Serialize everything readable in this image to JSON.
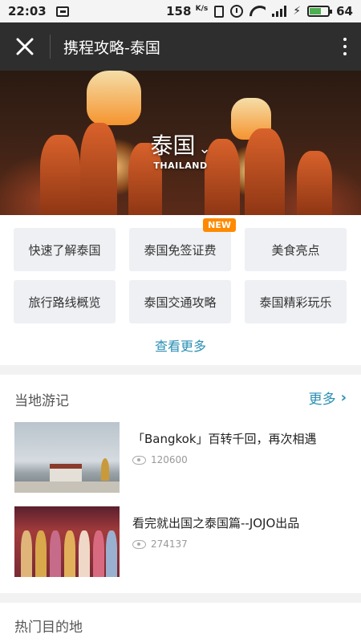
{
  "status_bar": {
    "time": "22:03",
    "speed": "158",
    "speed_unit": "K/s",
    "battery": "64",
    "battery_level": 0.64
  },
  "header": {
    "close_icon": "close-icon",
    "title": "携程攻略-泰国",
    "more_icon": "more-vertical-icon"
  },
  "hero": {
    "title": "泰国",
    "subtitle": "THAILAND"
  },
  "quick_links": {
    "items": [
      {
        "label": "快速了解泰国"
      },
      {
        "label": "泰国免签证费",
        "badge": "NEW"
      },
      {
        "label": "美食亮点"
      },
      {
        "label": "旅行路线概览"
      },
      {
        "label": "泰国交通攻略"
      },
      {
        "label": "泰国精彩玩乐"
      }
    ],
    "see_more": "查看更多"
  },
  "local_diaries": {
    "heading": "当地游记",
    "more_label": "更多",
    "items": [
      {
        "title": "「Bangkok」百转千回，再次相遇",
        "views": "120600"
      },
      {
        "title": "看完就出国之泰国篇--JOJO出品",
        "views": "274137"
      }
    ]
  },
  "popular_destinations": {
    "heading": "热门目的地"
  },
  "colors": {
    "accent": "#2a8fb5",
    "badge": "#ff8a00",
    "header_bg": "#2e2e2e"
  }
}
